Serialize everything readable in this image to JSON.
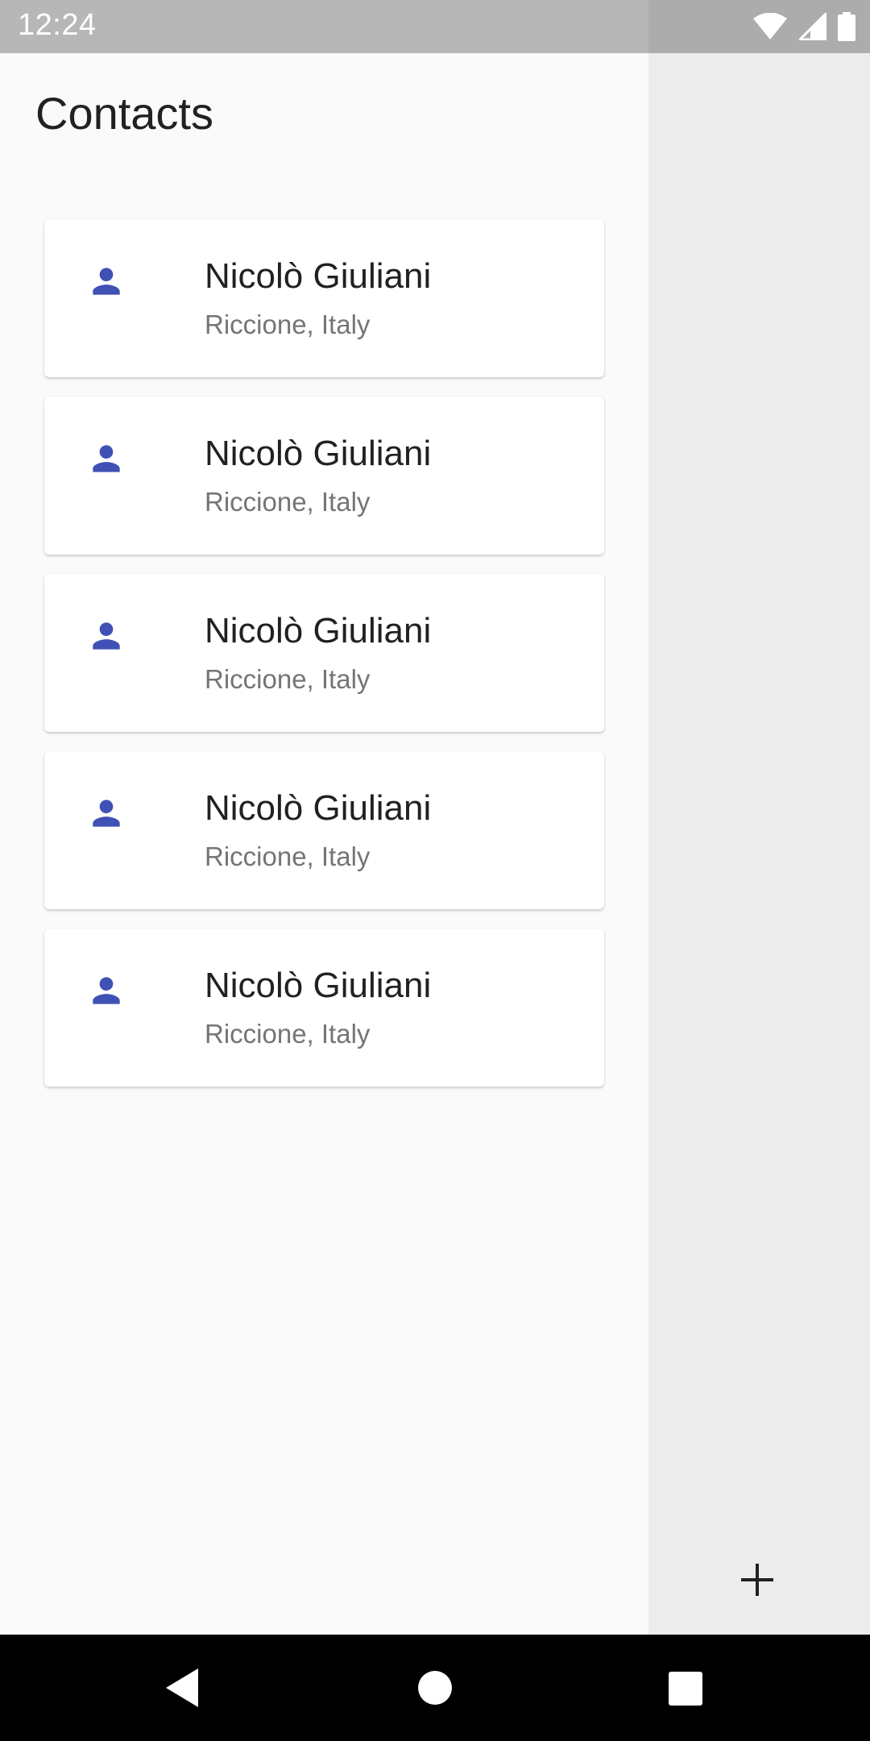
{
  "status_bar": {
    "time": "12:24"
  },
  "page": {
    "title": "Contacts"
  },
  "contacts": [
    {
      "name": "Nicolò Giuliani",
      "location": "Riccione, Italy"
    },
    {
      "name": "Nicolò Giuliani",
      "location": "Riccione, Italy"
    },
    {
      "name": "Nicolò Giuliani",
      "location": "Riccione, Italy"
    },
    {
      "name": "Nicolò Giuliani",
      "location": "Riccione, Italy"
    },
    {
      "name": "Nicolò Giuliani",
      "location": "Riccione, Italy"
    }
  ],
  "icons": {
    "avatar": "person-icon",
    "add": "plus-icon",
    "nav_back": "back-triangle-icon",
    "nav_home": "home-circle-icon",
    "nav_recents": "recents-square-icon"
  },
  "colors": {
    "accent": "#3f51b5",
    "status_bar": "#b7b7b7",
    "drawer_bg": "#fafafa",
    "side_panel_bg": "#ececec",
    "nav_bar": "#000000"
  }
}
